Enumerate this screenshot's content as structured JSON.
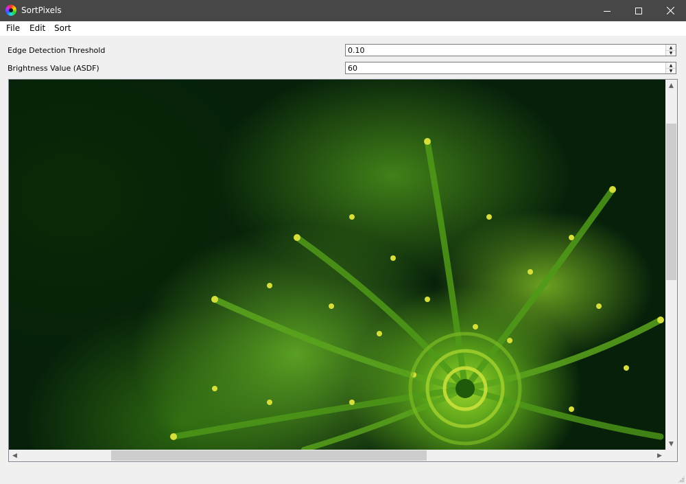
{
  "window": {
    "title": "SortPixels",
    "icon": "rgb-color-wheel-icon",
    "controls": [
      "minimize",
      "maximize",
      "close"
    ]
  },
  "menu": {
    "items": [
      "File",
      "Edit",
      "Sort"
    ]
  },
  "fields": {
    "edge_threshold": {
      "label": "Edge Detection Threshold",
      "value": "0.10"
    },
    "brightness": {
      "label": "Brightness Value (ASDF)",
      "value": "60"
    }
  },
  "image_view": {
    "content": "green fern macro photo",
    "vertical_scroll_fraction": 0.0,
    "horizontal_scroll_fraction": 0.16
  }
}
